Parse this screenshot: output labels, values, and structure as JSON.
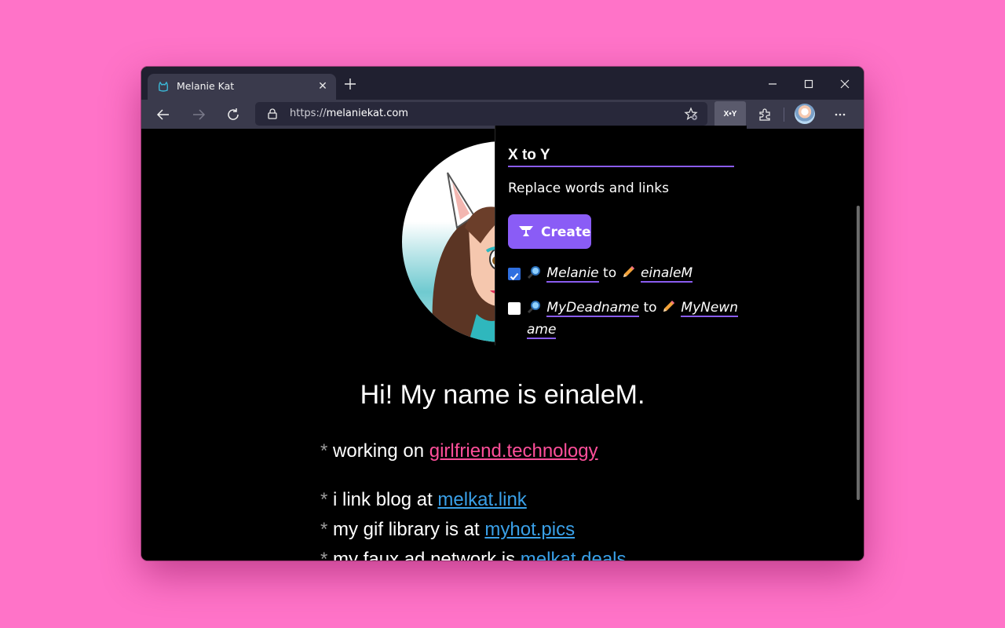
{
  "browser": {
    "tab_title": "Melanie Kat",
    "url_prefix": "https://",
    "url_domain": "melaniekat.com",
    "extension_badge": "X•Y"
  },
  "page": {
    "heading": "Hi! My name is einaleM.",
    "lines": [
      {
        "bullet": "*",
        "text": "working on ",
        "link": "girlfriend.technology"
      },
      {
        "bullet": "*",
        "text": "i link blog at ",
        "link": "melkat.link"
      },
      {
        "bullet": "*",
        "text": "my gif library is at ",
        "link": "myhot.pics"
      },
      {
        "bullet": "*",
        "text": "my faux ad network is ",
        "link": "melkat.deals"
      }
    ]
  },
  "popup": {
    "title": "X to Y",
    "subtitle": "Replace words and links",
    "create_label": "Create",
    "rules": [
      {
        "checked": true,
        "from": "Melanie",
        "joiner": "to",
        "to": "einaleM"
      },
      {
        "checked": false,
        "from": "MyDeadname",
        "joiner": "to",
        "to": "MyNewname"
      }
    ]
  },
  "colors": {
    "background": "#ff73c8",
    "accent": "#8a5cf6",
    "link_pink": "#ff4f9a",
    "link_blue": "#3aa0e8"
  }
}
